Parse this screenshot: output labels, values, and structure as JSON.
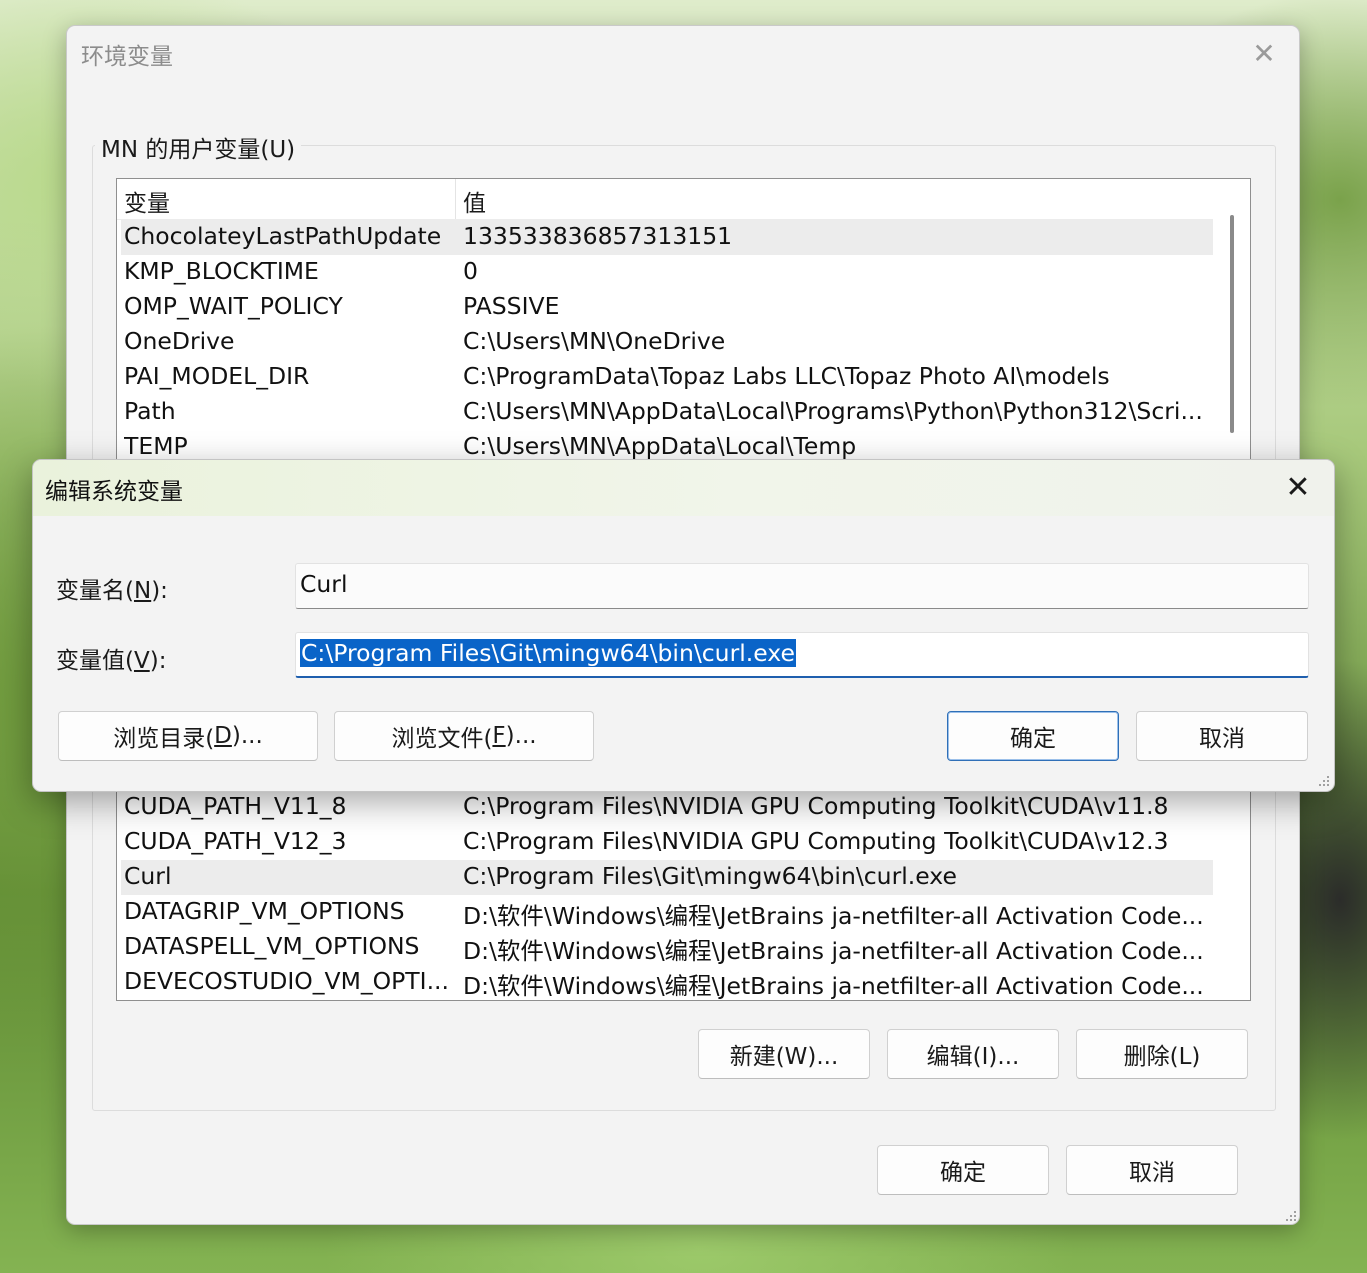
{
  "main_window": {
    "title": "环境变量",
    "user_vars_group_label": "MN 的用户变量(U)",
    "columns": {
      "name": "变量",
      "value": "值"
    },
    "user_variables": [
      {
        "name": "ChocolateyLastPathUpdate",
        "value": "133533836857313151"
      },
      {
        "name": "KMP_BLOCKTIME",
        "value": "0"
      },
      {
        "name": "OMP_WAIT_POLICY",
        "value": "PASSIVE"
      },
      {
        "name": "OneDrive",
        "value": "C:\\Users\\MN\\OneDrive"
      },
      {
        "name": "PAI_MODEL_DIR",
        "value": "C:\\ProgramData\\Topaz Labs LLC\\Topaz Photo AI\\models"
      },
      {
        "name": "Path",
        "value": "C:\\Users\\MN\\AppData\\Local\\Programs\\Python\\Python312\\Scri..."
      },
      {
        "name": "TEMP",
        "value": "C:\\Users\\MN\\AppData\\Local\\Temp"
      }
    ],
    "system_variables": [
      {
        "name": "CUDA_PATH_V11_8",
        "value": "C:\\Program Files\\NVIDIA GPU Computing Toolkit\\CUDA\\v11.8"
      },
      {
        "name": "CUDA_PATH_V12_3",
        "value": "C:\\Program Files\\NVIDIA GPU Computing Toolkit\\CUDA\\v12.3"
      },
      {
        "name": "Curl",
        "value": "C:\\Program Files\\Git\\mingw64\\bin\\curl.exe"
      },
      {
        "name": "DATAGRIP_VM_OPTIONS",
        "value": "D:\\软件\\Windows\\编程\\JetBrains ja-netfilter-all Activation Code..."
      },
      {
        "name": "DATASPELL_VM_OPTIONS",
        "value": "D:\\软件\\Windows\\编程\\JetBrains ja-netfilter-all Activation Code..."
      },
      {
        "name": "DEVECOSTUDIO_VM_OPTI...",
        "value": "D:\\软件\\Windows\\编程\\JetBrains ja-netfilter-all Activation Code..."
      }
    ],
    "selected_user_row": 0,
    "selected_system_row": 2,
    "buttons": {
      "new": "新建(W)...",
      "edit": "编辑(I)...",
      "delete": "删除(L)",
      "ok": "确定",
      "cancel": "取消"
    }
  },
  "edit_dialog": {
    "title": "编辑系统变量",
    "name_label_pre": "变量名(",
    "name_label_key": "N",
    "name_label_post": "):",
    "value_label_pre": "变量值(",
    "value_label_key": "V",
    "value_label_post": "):",
    "name_value": "Curl",
    "value_value": "C:\\Program Files\\Git\\mingw64\\bin\\curl.exe",
    "buttons": {
      "browse_dir_pre": "浏览目录(",
      "browse_dir_key": "D",
      "browse_dir_post": ")...",
      "browse_file_pre": "浏览文件(",
      "browse_file_key": "F",
      "browse_file_post": ")...",
      "ok": "确定",
      "cancel": "取消"
    }
  },
  "colors": {
    "selection": "#0a64c8",
    "focus_underline": "#1f5fae",
    "primary_button_border": "#2f6fb7"
  }
}
